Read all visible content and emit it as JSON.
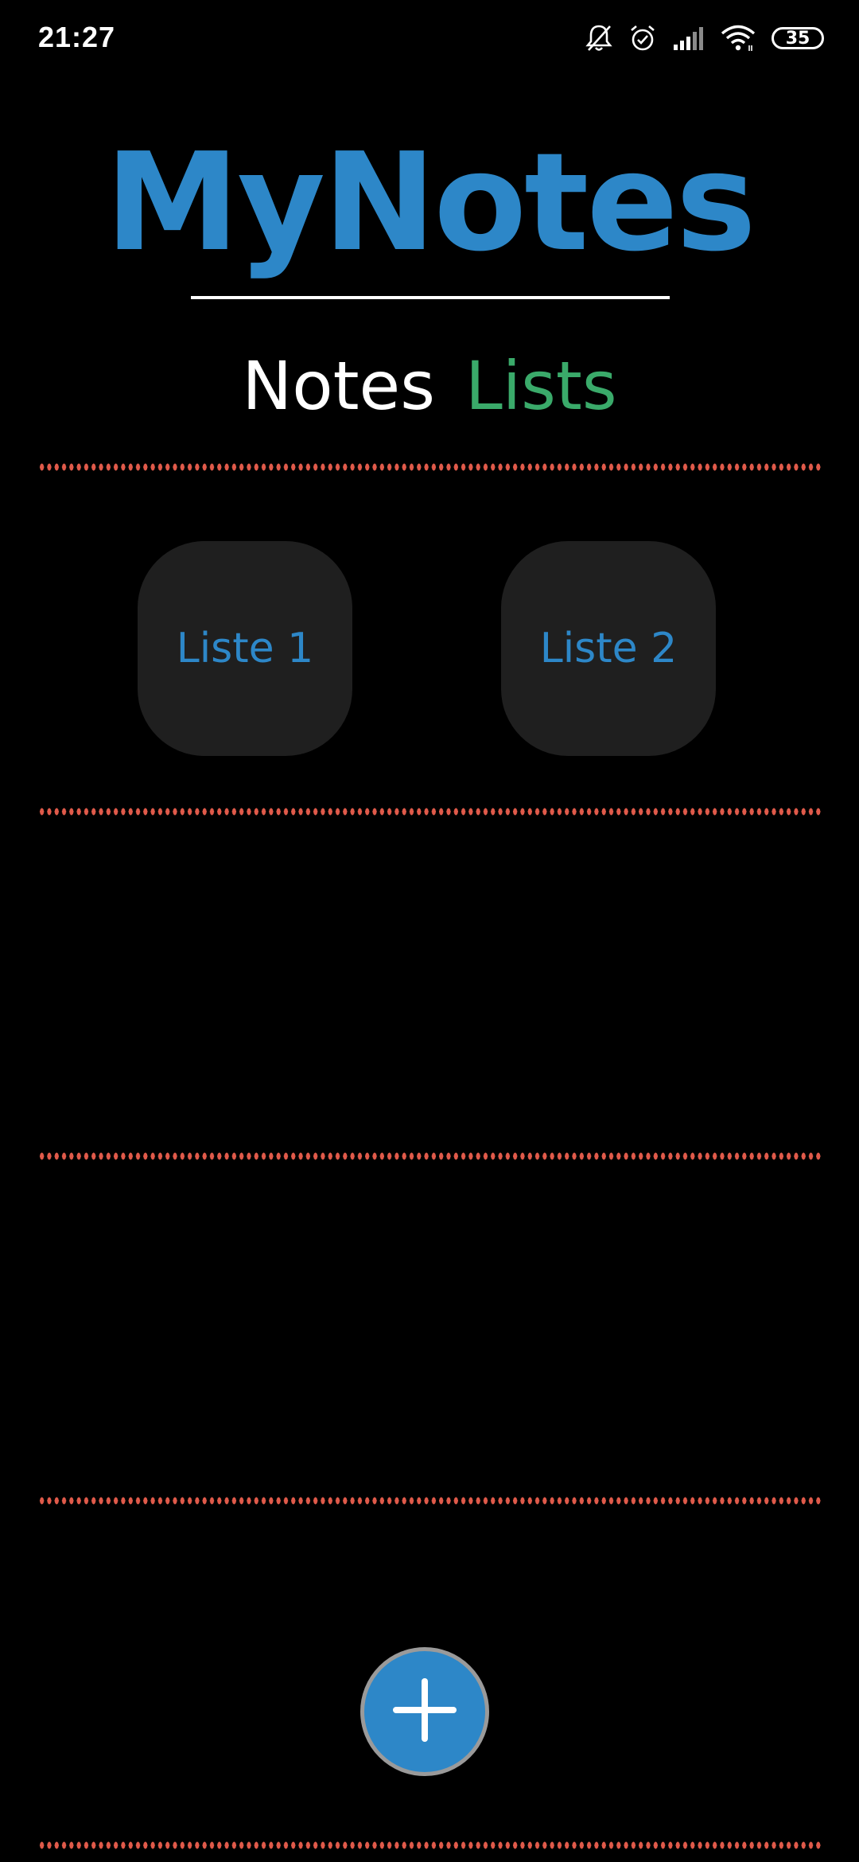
{
  "status_bar": {
    "time": "21:27",
    "battery_level": "35",
    "icons": [
      "bell-off-icon",
      "alarm-icon",
      "signal-icon",
      "wifi-icon",
      "battery-icon"
    ]
  },
  "header": {
    "title": "MyNotes"
  },
  "tabs": [
    {
      "label": "Notes",
      "active": false
    },
    {
      "label": "Lists",
      "active": true
    }
  ],
  "lists": [
    {
      "label": "Liste 1"
    },
    {
      "label": "Liste 2"
    }
  ],
  "fab": {
    "icon": "plus-icon"
  },
  "colors": {
    "background": "#000000",
    "brand_blue": "#2d87c8",
    "tab_active_green": "#3aaa6a",
    "tab_inactive": "#ffffff",
    "card_background": "#1f1f1f",
    "separator_red": "#e05a4a",
    "fab_border": "#9a9a9a"
  }
}
